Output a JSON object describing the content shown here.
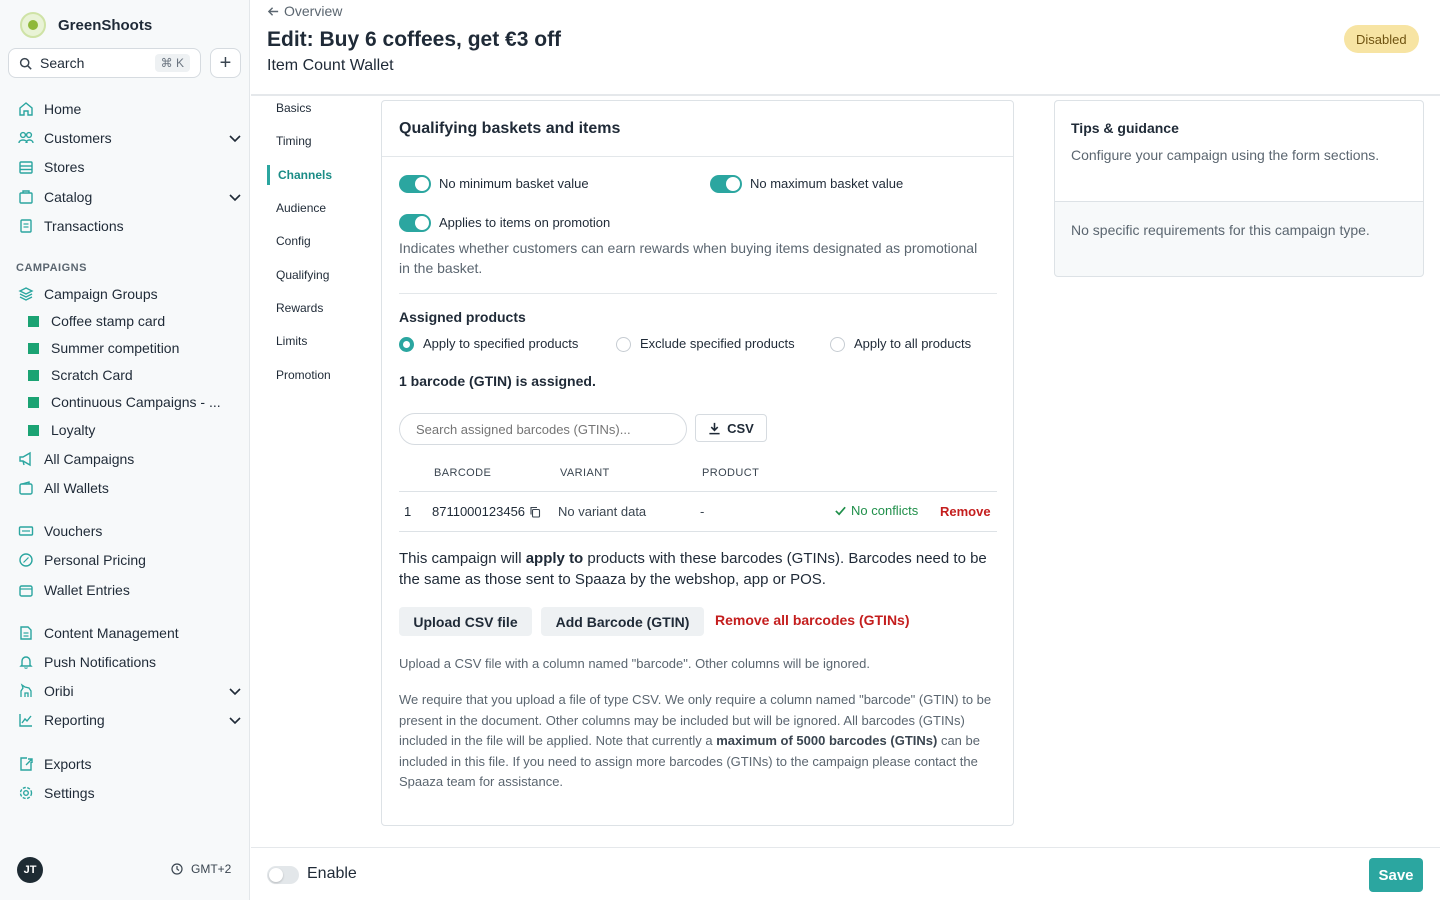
{
  "app": {
    "name": "GreenShoots"
  },
  "sidebar": {
    "search_label": "Search",
    "search_shortcut": "⌘ K",
    "nav_top": [
      {
        "label": "Home"
      },
      {
        "label": "Customers"
      },
      {
        "label": "Stores"
      },
      {
        "label": "Catalog"
      },
      {
        "label": "Transactions"
      }
    ],
    "campaigns_heading": "CAMPAIGNS",
    "campaign_groups_label": "Campaign Groups",
    "campaign_groups": [
      {
        "label": "Coffee stamp card"
      },
      {
        "label": "Summer competition"
      },
      {
        "label": "Scratch Card"
      },
      {
        "label": "Continuous Campaigns - ..."
      },
      {
        "label": "Loyalty"
      }
    ],
    "all_campaigns": "All Campaigns",
    "all_wallets": "All Wallets",
    "nav_mid": [
      {
        "label": "Vouchers"
      },
      {
        "label": "Personal Pricing"
      },
      {
        "label": "Wallet Entries"
      }
    ],
    "nav_content": [
      {
        "label": "Content Management"
      },
      {
        "label": "Push Notifications"
      },
      {
        "label": "Oribi"
      },
      {
        "label": "Reporting"
      }
    ],
    "nav_bottom": [
      {
        "label": "Exports"
      },
      {
        "label": "Settings"
      }
    ],
    "user_initials": "JT",
    "timezone": "GMT+2"
  },
  "header": {
    "back_label": "Overview",
    "title": "Edit: Buy 6 coffees, get €3 off",
    "subtitle": "Item Count Wallet",
    "status": "Disabled"
  },
  "section_nav": [
    {
      "label": "Basics"
    },
    {
      "label": "Timing"
    },
    {
      "label": "Channels"
    },
    {
      "label": "Audience"
    },
    {
      "label": "Config"
    },
    {
      "label": "Qualifying"
    },
    {
      "label": "Rewards"
    },
    {
      "label": "Limits"
    },
    {
      "label": "Promotion"
    }
  ],
  "qualifying": {
    "heading": "Qualifying baskets and items",
    "no_min_label": "No minimum basket value",
    "no_max_label": "No maximum basket value",
    "promo_label": "Applies to items on promotion",
    "promo_help": "Indicates whether customers can earn rewards when buying items designated as promotional in the basket.",
    "assigned_heading": "Assigned products",
    "radio_specified": "Apply to specified products",
    "radio_exclude": "Exclude specified products",
    "radio_all": "Apply to all products",
    "assigned_count": "1 barcode (GTIN) is assigned.",
    "search_placeholder": "Search assigned barcodes (GTINs)...",
    "csv_label": "CSV",
    "columns": {
      "barcode": "BARCODE",
      "variant": "VARIANT",
      "product": "PRODUCT"
    },
    "rows": [
      {
        "index": "1",
        "barcode": "8711000123456",
        "variant": "No variant data",
        "product": "-",
        "status": "No conflicts",
        "remove": "Remove"
      }
    ],
    "apply_text_1": "This campaign will ",
    "apply_text_bold": "apply to",
    "apply_text_2": " products with these barcodes (GTINs). Barcodes need to be the same as those sent to Spaaza by the webshop, app or POS.",
    "upload_btn": "Upload CSV file",
    "add_btn": "Add Barcode (GTIN)",
    "remove_all_btn": "Remove all barcodes (GTINs)",
    "upload_note": "Upload a CSV file with a column named \"barcode\". Other columns will be ignored.",
    "req_1": "We require that you upload a file of type CSV. We only require a column named \"barcode\" (GTIN) to be present in the document. Other columns may be included but will be ignored. All barcodes (GTINs) included in the file will be applied. Note that currently a ",
    "req_bold": "maximum of 5000 barcodes (GTINs)",
    "req_2": " can be included in this file. If you need to assign more barcodes (GTINs) to the campaign please contact the Spaaza team for assistance."
  },
  "tips": {
    "title": "Tips & guidance",
    "description": "Configure your campaign using the form sections.",
    "none": "No specific requirements for this campaign type."
  },
  "footer": {
    "enable_label": "Enable",
    "save_label": "Save"
  },
  "colors": {
    "accent": "#2ba6a0",
    "danger": "#c41e1e",
    "success": "#1f8f4a",
    "badge_bg": "#f7e4a3"
  }
}
